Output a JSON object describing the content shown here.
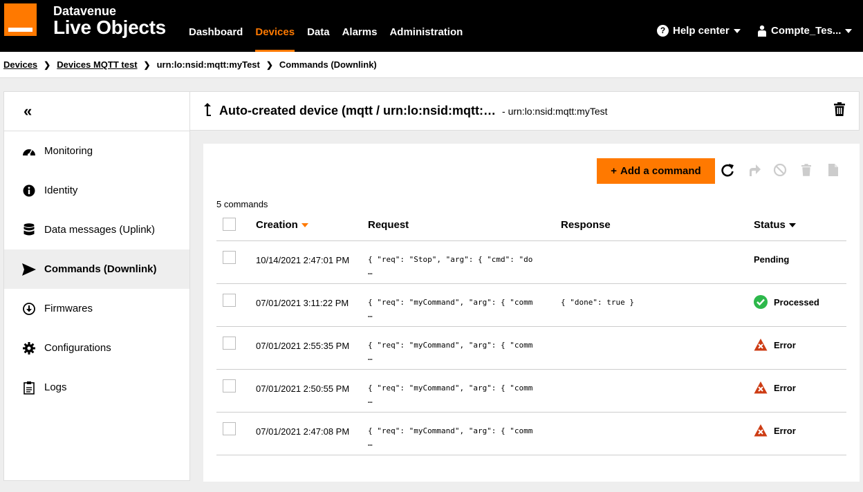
{
  "app": {
    "brand_top": "Datavenue",
    "brand_main": "Live Objects",
    "accent": "#ff7900"
  },
  "nav": [
    {
      "label": "Dashboard",
      "active": false
    },
    {
      "label": "Devices",
      "active": true
    },
    {
      "label": "Data",
      "active": false
    },
    {
      "label": "Alarms",
      "active": false
    },
    {
      "label": "Administration",
      "active": false
    }
  ],
  "topright": {
    "help": "Help center",
    "account": "Compte_Tes..."
  },
  "breadcrumb": [
    "Devices",
    "Devices MQTT test",
    "urn:lo:nsid:mqtt:myTest",
    "Commands (Downlink)"
  ],
  "sidebar": {
    "collapse": "«",
    "items": [
      {
        "label": "Monitoring",
        "icon": "gauge-icon"
      },
      {
        "label": "Identity",
        "icon": "info-icon"
      },
      {
        "label": "Data messages (Uplink)",
        "icon": "database-icon"
      },
      {
        "label": "Commands (Downlink)",
        "icon": "send-icon",
        "active": true
      },
      {
        "label": "Firmwares",
        "icon": "download-icon"
      },
      {
        "label": "Configurations",
        "icon": "gear-icon"
      },
      {
        "label": "Logs",
        "icon": "clipboard-icon"
      }
    ]
  },
  "header": {
    "title": "Auto-created device (mqtt / urn:lo:nsid:mqtt:…",
    "subtitle": "- urn:lo:nsid:mqtt:myTest"
  },
  "toolbar": {
    "add_label": "Add a command",
    "add_icon": "+"
  },
  "table": {
    "count": "5 commands",
    "headers": {
      "creation": "Creation",
      "request": "Request",
      "response": "Response",
      "status": "Status"
    },
    "rows": [
      {
        "date": "10/14/2021 2:47:01 PM",
        "req": "{ \"req\": \"Stop\", \"arg\": { \"cmd\": \"do\n…",
        "resp": "",
        "status": "Pending",
        "status_type": "pending"
      },
      {
        "date": "07/01/2021 3:11:22 PM",
        "req": "{ \"req\": \"myCommand\", \"arg\": { \"comm\n…",
        "resp": "{ \"done\": true }",
        "status": "Processed",
        "status_type": "ok"
      },
      {
        "date": "07/01/2021 2:55:35 PM",
        "req": "{ \"req\": \"myCommand\", \"arg\": { \"comm\n…",
        "resp": "",
        "status": "Error",
        "status_type": "error"
      },
      {
        "date": "07/01/2021 2:50:55 PM",
        "req": "{ \"req\": \"myCommand\", \"arg\": { \"comm\n…",
        "resp": "",
        "status": "Error",
        "status_type": "error"
      },
      {
        "date": "07/01/2021 2:47:08 PM",
        "req": "{ \"req\": \"myCommand\", \"arg\": { \"comm\n…",
        "resp": "",
        "status": "Error",
        "status_type": "error"
      }
    ]
  },
  "colors": {
    "ok": "#2db84b",
    "error": "#cd3c14",
    "disabled": "#cccccc"
  }
}
